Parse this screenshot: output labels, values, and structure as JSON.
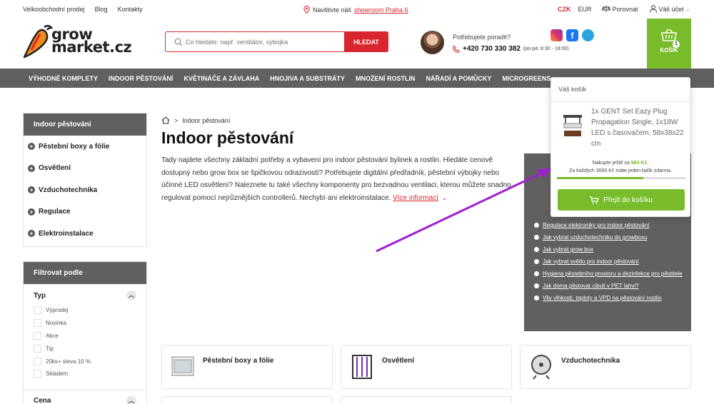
{
  "topbar": {
    "links": [
      "Velkoobchodní prodej",
      "Blog",
      "Kontakty"
    ],
    "visit_prefix": "Navštivte náš",
    "visit_link": "showroom Praha 6",
    "currency_active": "CZK",
    "currency_other": "EUR",
    "compare": "Porovnat",
    "account": "Váš účet"
  },
  "logo": {
    "line1": "grow",
    "line2": "market.cz"
  },
  "search": {
    "placeholder": "Co hledáte: např. ventilátor, výbojka",
    "button": "HLEDAT"
  },
  "help": {
    "title": "Potřebujete poradit?",
    "phone": "+420 730 330 382",
    "hours": "(po-pá: 8:30 - 18:00)"
  },
  "cart_button": {
    "label": "KOŠÍK",
    "count": "1"
  },
  "nav": [
    "VÝHODNÉ KOMPLETY",
    "INDOOR PĚSTOVÁNÍ",
    "KVĚTINÁČE A ZÁVLAHA",
    "HNOJIVA A SUBSTRÁTY",
    "MNOŽENÍ ROSTLIN",
    "NÁŘADÍ A POMŮCKY",
    "MICROGREENS"
  ],
  "sidebar": {
    "title": "Indoor pěstování",
    "items": [
      "Pěstební boxy a fólie",
      "Osvětlení",
      "Vzduchotechnika",
      "Regulace",
      "Elektroinstalace"
    ]
  },
  "filter": {
    "title": "Filtrovat podle",
    "type_label": "Typ",
    "options": [
      "Výprodej",
      "Novinka",
      "Akce",
      "Tip",
      "20ks+ sleva 10 %",
      "Skladem"
    ],
    "price_label": "Cena"
  },
  "breadcrumb": {
    "current": "Indoor pěstování"
  },
  "page": {
    "title": "Indoor pěstování",
    "description": "Tady najdete všechny základní potřeby a vybavení pro indoor pěstování bylinek a rostlin. Hledáte cenově dostupný nebo grow box se špičkovou odrazivostí? Potřebujete digitální předřadník, pěstební výbojky nebo účinné LED osvětlení? Naleznete tu také všechny komponenty pro bezvadnou ventilaci, kterou můžete snadno regulovat pomocí nejrůznějších controllerů. Nechybí ani elektroinstalace.",
    "more": "Více informací"
  },
  "articles": [
    "Regulace elektroniky pro indoor pěstování",
    "Jak vybrat vzduchotechniku do growboxu",
    "Jak vybrat grow box",
    "Jak vybrat světlo pro indoor pěstování",
    "Hygiena pěstebního prostoru a dezinfekce pro pěstitele",
    "Jak doma pěstovat cibuli v PET lahvi?",
    "Vliv vlhkosti, teploty a VPD na pěstování rostlin"
  ],
  "categories": [
    "Pěstební boxy a fólie",
    "Osvětlení",
    "Vzduchotechnika"
  ],
  "cart_popup": {
    "title": "Váš košík",
    "item": "1x GENT Set Eazy Plug Propagation Single, 1x18W LED s časovačem, 58x38x22 cm",
    "note_prefix": "Nakupte ještě za",
    "note_amount": "984 Kč",
    "note_line2": "Za každých 3000 Kč máte jeden balík zdarma.",
    "progress": 0.67,
    "button": "Přejít do košíku"
  },
  "colors": {
    "accent_red": "#d9262e",
    "green": "#79bc2b",
    "nav_gray": "#606060",
    "arrow": "#a020d0"
  }
}
